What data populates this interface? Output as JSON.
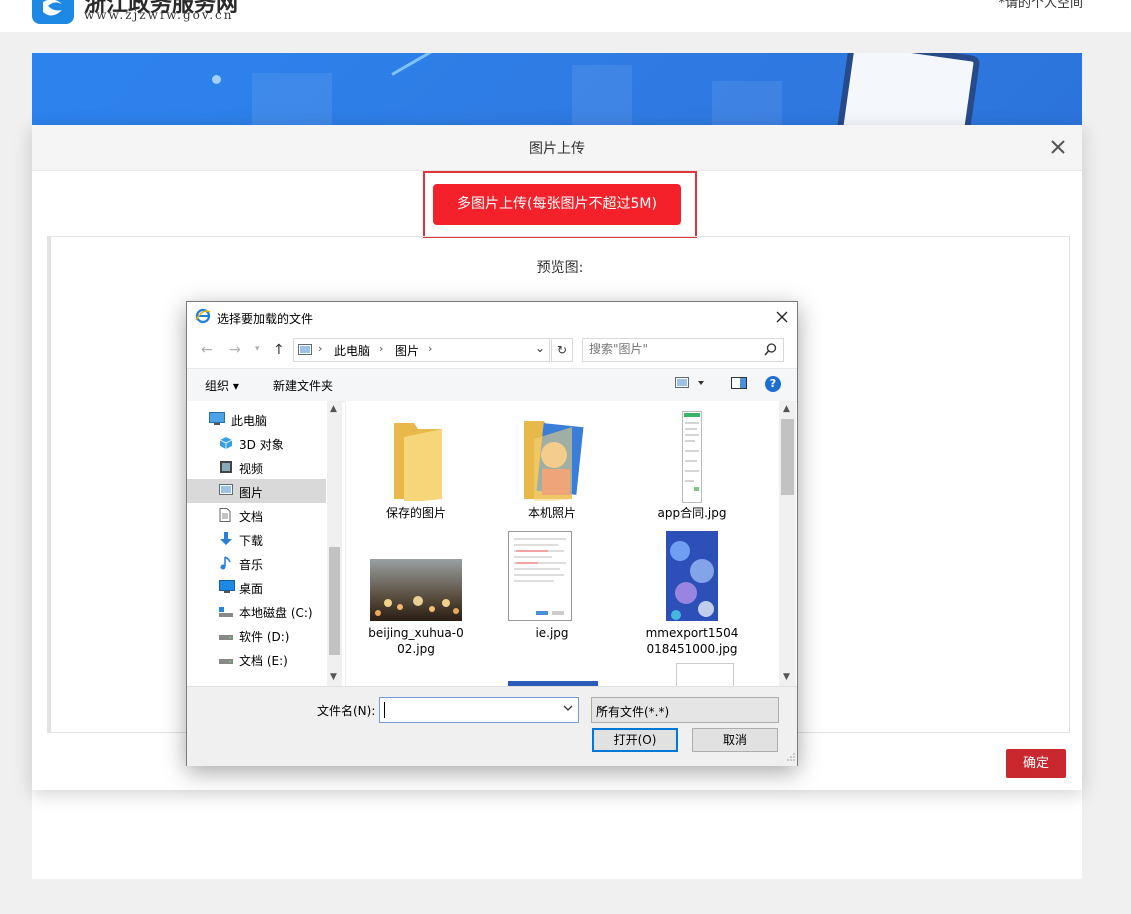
{
  "site": {
    "name": "浙江政务服务网",
    "url": "www.zjzwfw.gov.cn",
    "personal_link": "*请的个人空间"
  },
  "modal": {
    "title": "图片上传",
    "upload_button": "多图片上传(每张图片不超过5M)",
    "preview_label": "预览图:",
    "confirm_button": "确定",
    "accent_color": "#f5212a"
  },
  "dialog": {
    "title": "选择要加载的文件",
    "address": [
      "此电脑",
      "图片"
    ],
    "search_placeholder": "搜索\"图片\"",
    "toolbar": {
      "organize": "组织 ▾",
      "new_folder": "新建文件夹"
    },
    "nav_items": [
      {
        "label": "此电脑",
        "icon": "pc-icon"
      },
      {
        "label": "3D 对象",
        "icon": "3d-objects-icon"
      },
      {
        "label": "视频",
        "icon": "video-icon"
      },
      {
        "label": "图片",
        "icon": "pictures-icon",
        "selected": true
      },
      {
        "label": "文档",
        "icon": "documents-icon"
      },
      {
        "label": "下载",
        "icon": "download-icon"
      },
      {
        "label": "音乐",
        "icon": "music-icon"
      },
      {
        "label": "桌面",
        "icon": "desktop-icon"
      },
      {
        "label": "本地磁盘 (C:)",
        "icon": "drive-icon"
      },
      {
        "label": "软件 (D:)",
        "icon": "drive-icon"
      },
      {
        "label": "文档 (E:)",
        "icon": "drive-icon"
      }
    ],
    "files": [
      {
        "label": "保存的图片",
        "kind": "folder"
      },
      {
        "label": "本机照片",
        "kind": "folder-photo"
      },
      {
        "label": "app合同.jpg",
        "kind": "doc-image"
      },
      {
        "label": "beijing_xuhua-0\n02.jpg",
        "kind": "bokeh-image"
      },
      {
        "label": "ie.jpg",
        "kind": "screenshot-image"
      },
      {
        "label": "mmexport1504\n018451000.jpg",
        "kind": "art-image"
      }
    ],
    "filename_label": "文件名(N):",
    "filename_value": "",
    "filetype_value": "所有文件(*.*)",
    "open_button": "打开(O)",
    "cancel_button": "取消"
  }
}
